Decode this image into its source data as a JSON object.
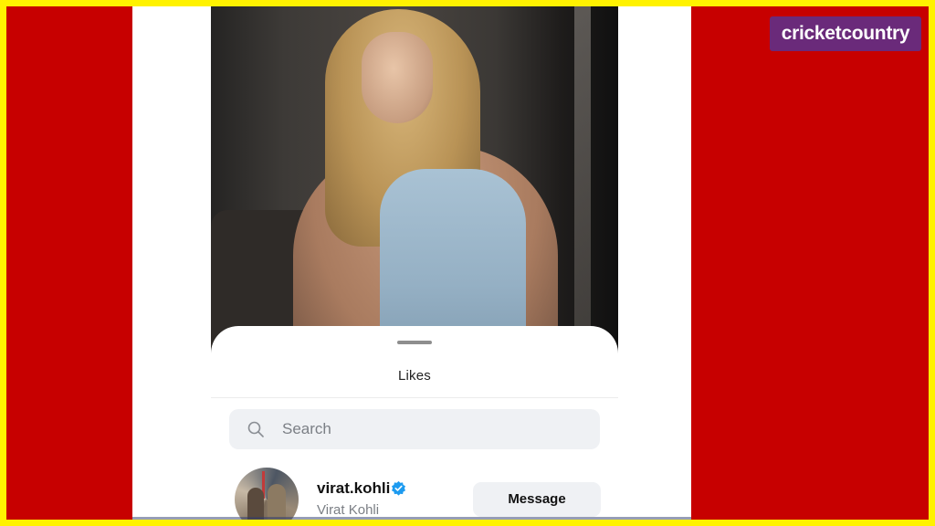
{
  "brand": {
    "logo_text": "cricketcountry",
    "background_color": "#c70000",
    "border_color": "#fff200",
    "logo_color": "#6a2a7a"
  },
  "likes_sheet": {
    "title": "Likes",
    "search": {
      "placeholder": "Search",
      "icon": "search-icon"
    },
    "users": [
      {
        "username": "virat.kohli",
        "full_name": "Virat Kohli",
        "verified": true,
        "verified_color": "#1d9bf0",
        "action_label": "Message"
      }
    ]
  }
}
